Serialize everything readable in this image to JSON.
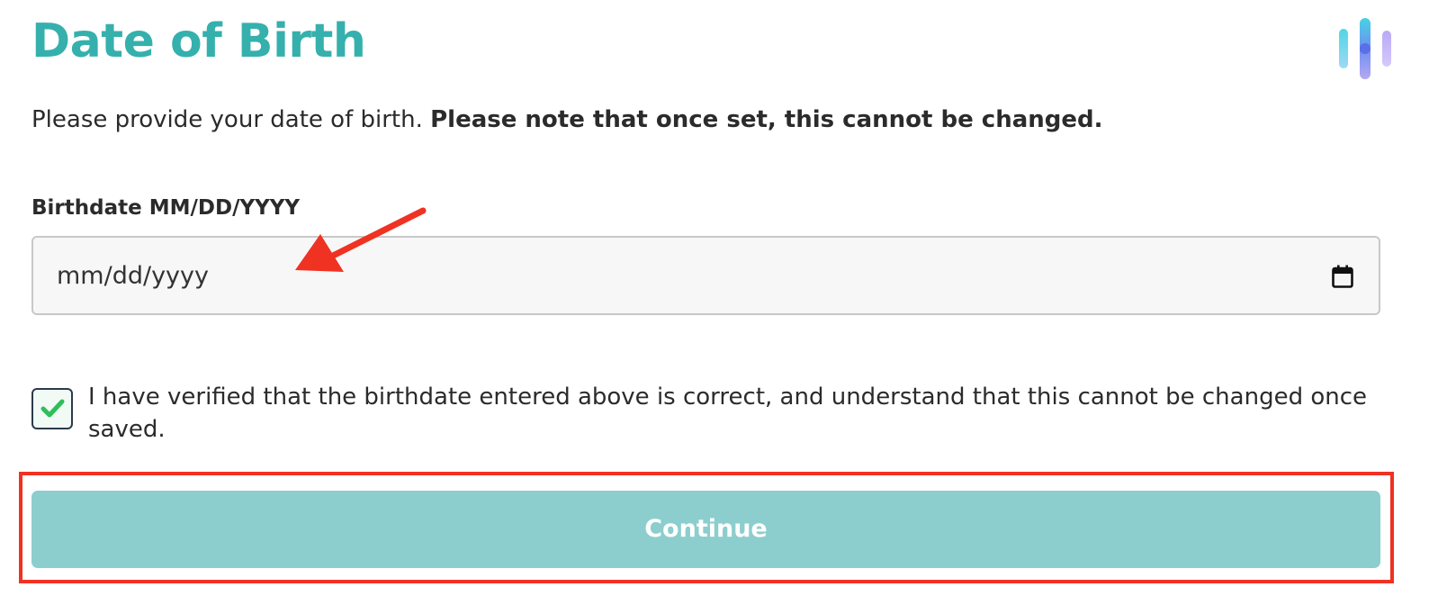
{
  "header": {
    "title": "Date of Birth",
    "logo_icon": "brand-bars-icon"
  },
  "intro": {
    "text": "Please provide your date of birth. ",
    "bold_text": "Please note that once set, this cannot be changed."
  },
  "birthdate_field": {
    "label": "Birthdate MM/DD/YYYY",
    "placeholder": "mm/dd/yyyy",
    "value": "",
    "icon": "calendar-icon"
  },
  "verification": {
    "checked": true,
    "label": "I have verified that the birthdate entered above is correct, and understand that this cannot be changed once saved.",
    "icon": "check-icon"
  },
  "actions": {
    "continue_label": "Continue"
  },
  "annotations": {
    "arrow_icon": "red-arrow-icon",
    "highlight_color": "#f03222"
  },
  "colors": {
    "title": "#35b0ad",
    "button_bg": "#8ccecd",
    "button_text": "#ffffff",
    "check": "#2fbf5a",
    "annotation": "#f03222"
  }
}
